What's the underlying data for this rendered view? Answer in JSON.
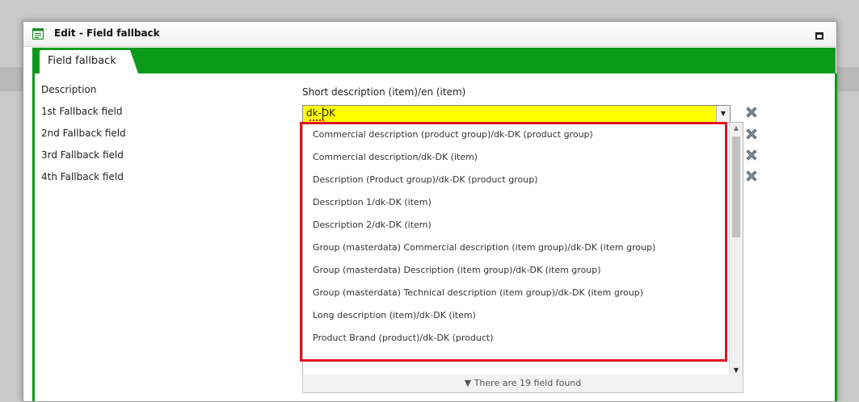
{
  "window": {
    "title": "Edit - Field fallback"
  },
  "tabs": [
    {
      "label": "Field fallback"
    }
  ],
  "form": {
    "labels": {
      "description": "Description",
      "fallback1": "1st Fallback field",
      "fallback2": "2nd Fallback field",
      "fallback3": "3rd Fallback field",
      "fallback4": "4th Fallback field"
    },
    "description_value": "Short description (item)/en (item)",
    "fallback1_input": "dk-DK"
  },
  "dropdown": {
    "items": [
      "Commercial description (product group)/dk-DK (product group)",
      "Commercial description/dk-DK (item)",
      "Description (Product group)/dk-DK (product group)",
      "Description 1/dk-DK (item)",
      "Description 2/dk-DK (item)",
      "Group (masterdata) Commercial description (item group)/dk-DK (item group)",
      "Group (masterdata) Description (item group)/dk-DK (item group)",
      "Group (masterdata) Technical description (item group)/dk-DK (item group)",
      "Long description (item)/dk-DK (item)",
      "Product Brand (product)/dk-DK (product)"
    ],
    "footer": "There are 19 field found"
  },
  "colors": {
    "accent": "#0b9a1a",
    "input_highlight": "#ffff00",
    "annotation": "#e0141b"
  },
  "icons": {
    "window": "form-icon",
    "clear": "x-icon",
    "maximize": "maximize-icon",
    "dropdown": "chevron-down-icon",
    "footer": "triangle-down-icon"
  }
}
